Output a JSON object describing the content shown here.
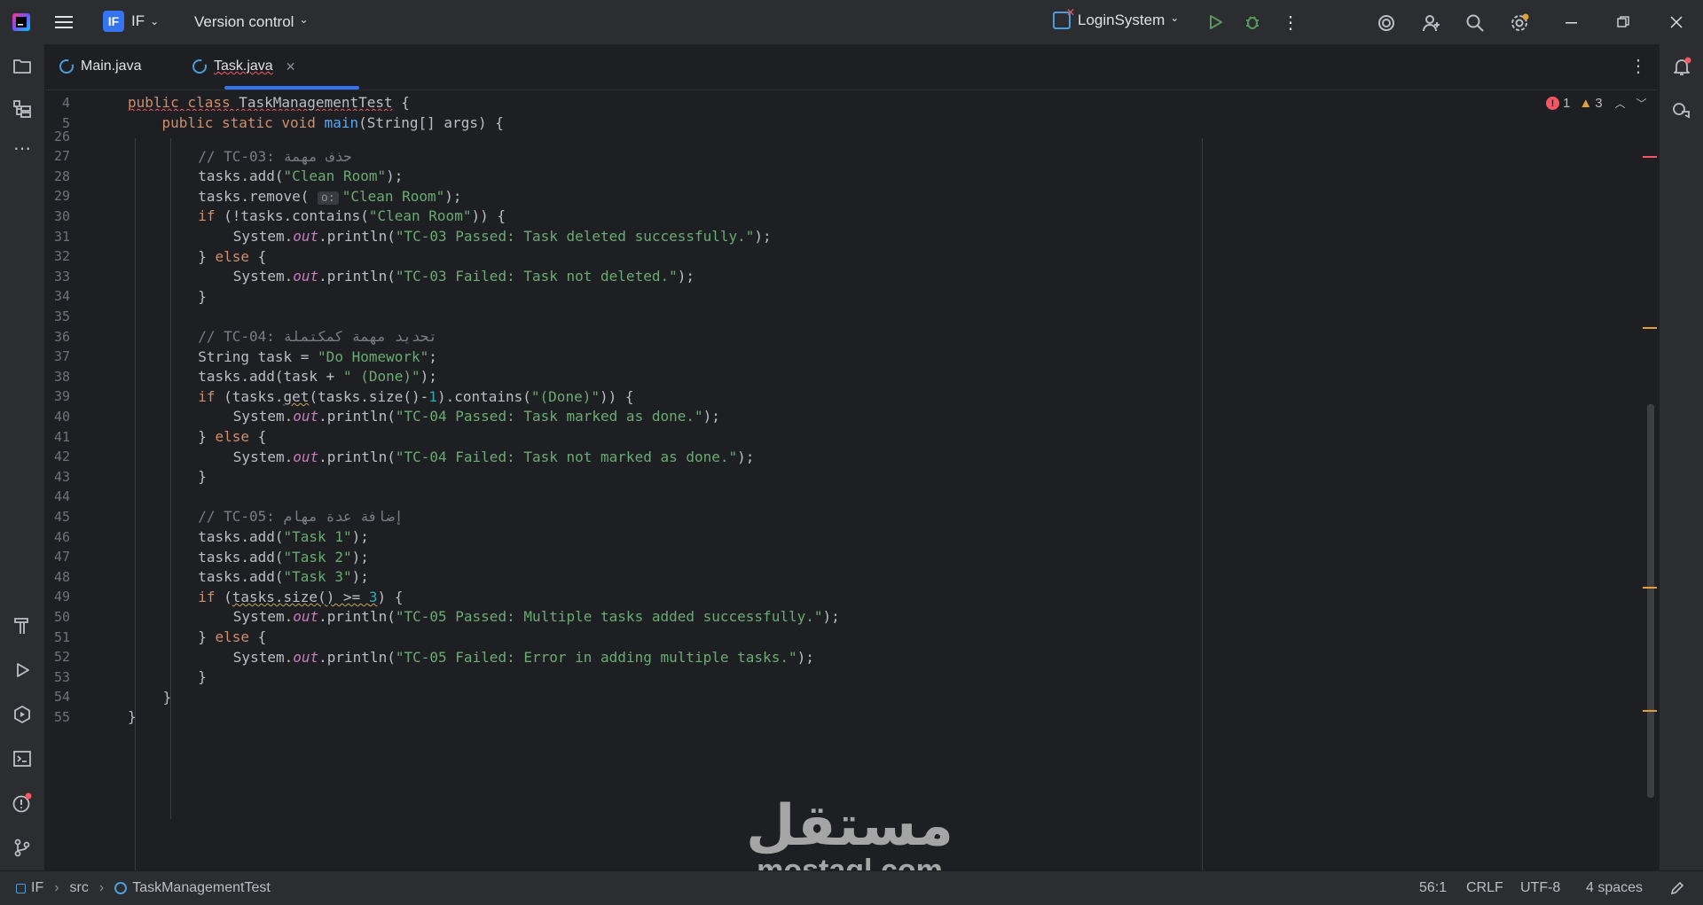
{
  "titlebar": {
    "project_badge": "IF",
    "project_name": "IF",
    "vcs_label": "Version control",
    "run_config": "LoginSystem"
  },
  "tabs": [
    {
      "label": "Main.java",
      "active": false
    },
    {
      "label": "Task.java",
      "active": true
    }
  ],
  "sticky_lines": [
    {
      "num": "4",
      "tokens": [
        [
          "kw wavy-red",
          "public class "
        ],
        [
          "wavy-red",
          "TaskManagementTest"
        ],
        [
          "",
          " {"
        ]
      ]
    },
    {
      "num": "5",
      "tokens": [
        [
          "kw",
          "    public static void "
        ],
        [
          "fn",
          "main"
        ],
        [
          "",
          "(String[] args) {"
        ]
      ]
    }
  ],
  "lines": [
    {
      "num": "26",
      "indent": 0,
      "tokens": []
    },
    {
      "num": "27",
      "indent": 8,
      "tokens": [
        [
          "cm",
          "// TC-03: حذف مهمة"
        ]
      ]
    },
    {
      "num": "28",
      "indent": 8,
      "tokens": [
        [
          "",
          "tasks.add("
        ],
        [
          "str",
          "\"Clean Room\""
        ],
        [
          "",
          ");"
        ]
      ]
    },
    {
      "num": "29",
      "indent": 8,
      "tokens": [
        [
          "",
          "tasks.remove( "
        ],
        [
          "hint",
          "o:"
        ],
        [
          "str",
          "\"Clean Room\""
        ],
        [
          "",
          ");"
        ]
      ]
    },
    {
      "num": "30",
      "indent": 8,
      "tokens": [
        [
          "kw",
          "if "
        ],
        [
          "",
          "(!tasks.contains("
        ],
        [
          "str",
          "\"Clean Room\""
        ],
        [
          "",
          ")) {"
        ]
      ]
    },
    {
      "num": "31",
      "indent": 12,
      "tokens": [
        [
          "",
          "System."
        ],
        [
          "fld",
          "out"
        ],
        [
          "",
          ".println("
        ],
        [
          "str",
          "\"TC-03 Passed: Task deleted successfully.\""
        ],
        [
          "",
          ");"
        ]
      ]
    },
    {
      "num": "32",
      "indent": 8,
      "tokens": [
        [
          "",
          "} "
        ],
        [
          "kw",
          "else"
        ],
        [
          "",
          " {"
        ]
      ]
    },
    {
      "num": "33",
      "indent": 12,
      "tokens": [
        [
          "",
          "System."
        ],
        [
          "fld",
          "out"
        ],
        [
          "",
          ".println("
        ],
        [
          "str",
          "\"TC-03 Failed: Task not deleted.\""
        ],
        [
          "",
          ");"
        ]
      ]
    },
    {
      "num": "34",
      "indent": 8,
      "tokens": [
        [
          "",
          "}"
        ]
      ]
    },
    {
      "num": "35",
      "indent": 0,
      "tokens": []
    },
    {
      "num": "36",
      "indent": 8,
      "tokens": [
        [
          "cm",
          "// TC-04: تحديد مهمة كمكتملة"
        ]
      ]
    },
    {
      "num": "37",
      "indent": 8,
      "tokens": [
        [
          "",
          "String task = "
        ],
        [
          "str",
          "\"Do Homework\""
        ],
        [
          "",
          ";"
        ]
      ]
    },
    {
      "num": "38",
      "indent": 8,
      "tokens": [
        [
          "",
          "tasks.add(task + "
        ],
        [
          "str",
          "\" (Done)\""
        ],
        [
          "",
          ");"
        ]
      ]
    },
    {
      "num": "39",
      "indent": 8,
      "tokens": [
        [
          "kw",
          "if "
        ],
        [
          "",
          "(tasks."
        ],
        [
          "wavy-yel",
          "get"
        ],
        [
          "",
          "(tasks.size()-"
        ],
        [
          "num",
          "1"
        ],
        [
          "",
          ").contains("
        ],
        [
          "str",
          "\"(Done)\""
        ],
        [
          "",
          ")) {"
        ]
      ]
    },
    {
      "num": "40",
      "indent": 12,
      "tokens": [
        [
          "",
          "System."
        ],
        [
          "fld",
          "out"
        ],
        [
          "",
          ".println("
        ],
        [
          "str",
          "\"TC-04 Passed: Task marked as done.\""
        ],
        [
          "",
          ");"
        ]
      ]
    },
    {
      "num": "41",
      "indent": 8,
      "tokens": [
        [
          "",
          "} "
        ],
        [
          "kw",
          "else"
        ],
        [
          "",
          " {"
        ]
      ]
    },
    {
      "num": "42",
      "indent": 12,
      "tokens": [
        [
          "",
          "System."
        ],
        [
          "fld",
          "out"
        ],
        [
          "",
          ".println("
        ],
        [
          "str",
          "\"TC-04 Failed: Task not marked as done.\""
        ],
        [
          "",
          ");"
        ]
      ]
    },
    {
      "num": "43",
      "indent": 8,
      "tokens": [
        [
          "",
          "}"
        ]
      ]
    },
    {
      "num": "44",
      "indent": 0,
      "tokens": []
    },
    {
      "num": "45",
      "indent": 8,
      "tokens": [
        [
          "cm",
          "// TC-05: إضافة عدة مهام"
        ]
      ]
    },
    {
      "num": "46",
      "indent": 8,
      "tokens": [
        [
          "",
          "tasks.add("
        ],
        [
          "str",
          "\"Task 1\""
        ],
        [
          "",
          ");"
        ]
      ]
    },
    {
      "num": "47",
      "indent": 8,
      "tokens": [
        [
          "",
          "tasks.add("
        ],
        [
          "str",
          "\"Task 2\""
        ],
        [
          "",
          ");"
        ]
      ]
    },
    {
      "num": "48",
      "indent": 8,
      "tokens": [
        [
          "",
          "tasks.add("
        ],
        [
          "str",
          "\"Task 3\""
        ],
        [
          "",
          ");"
        ]
      ]
    },
    {
      "num": "49",
      "indent": 8,
      "tokens": [
        [
          "kw",
          "if "
        ],
        [
          "",
          "("
        ],
        [
          "wavy-yel",
          "tasks.size() >= "
        ],
        [
          "num wavy-yel",
          "3"
        ],
        [
          "",
          ") {"
        ]
      ]
    },
    {
      "num": "50",
      "indent": 12,
      "tokens": [
        [
          "",
          "System."
        ],
        [
          "fld",
          "out"
        ],
        [
          "",
          ".println("
        ],
        [
          "str",
          "\"TC-05 Passed: Multiple tasks added successfully.\""
        ],
        [
          "",
          ");"
        ]
      ]
    },
    {
      "num": "51",
      "indent": 8,
      "tokens": [
        [
          "",
          "} "
        ],
        [
          "kw",
          "else"
        ],
        [
          "",
          " {"
        ]
      ]
    },
    {
      "num": "52",
      "indent": 12,
      "tokens": [
        [
          "",
          "System."
        ],
        [
          "fld",
          "out"
        ],
        [
          "",
          ".println("
        ],
        [
          "str",
          "\"TC-05 Failed: Error in adding multiple tasks.\""
        ],
        [
          "",
          ");"
        ]
      ]
    },
    {
      "num": "53",
      "indent": 8,
      "tokens": [
        [
          "",
          "}"
        ]
      ]
    },
    {
      "num": "54",
      "indent": 4,
      "tokens": [
        [
          "",
          "}"
        ]
      ]
    },
    {
      "num": "55",
      "indent": 0,
      "tokens": [
        [
          "",
          "}"
        ]
      ]
    }
  ],
  "inspections": {
    "errors": "1",
    "warnings": "3"
  },
  "statusbar": {
    "crumb_project": "IF",
    "crumb_src": "src",
    "crumb_class": "TaskManagementTest",
    "position": "56:1",
    "line_sep": "CRLF",
    "encoding": "UTF-8",
    "indent": "4 spaces"
  },
  "watermark": {
    "arabic": "مستقل",
    "latin": "mostaql.com"
  },
  "colors": {
    "accent": "#3574f0",
    "keyword": "#cf8e6d",
    "string": "#6aab73",
    "comment": "#7a7e85",
    "error": "#f75464",
    "warning": "#e0a03a"
  }
}
